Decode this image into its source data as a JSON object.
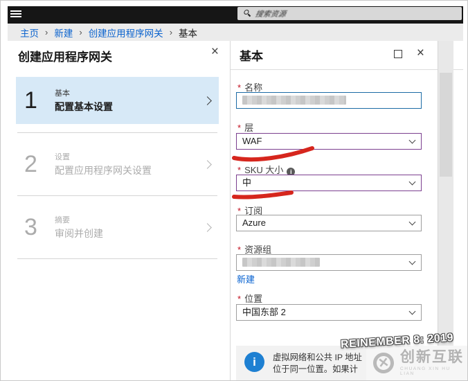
{
  "topbar": {
    "search_placeholder": "搜索资源"
  },
  "breadcrumb": {
    "separator": "›",
    "items": [
      {
        "label": "主页"
      },
      {
        "label": "新建"
      },
      {
        "label": "创建应用程序网关"
      },
      {
        "label": "基本"
      }
    ]
  },
  "left_panel": {
    "title": "创建应用程序网关",
    "steps": [
      {
        "number": "1",
        "label": "基本",
        "sublabel": "配置基本设置",
        "active": true
      },
      {
        "number": "2",
        "label": "设置",
        "sublabel": "配置应用程序网关设置",
        "active": false
      },
      {
        "number": "3",
        "label": "摘要",
        "sublabel": "审阅并创建",
        "active": false
      }
    ]
  },
  "right_panel": {
    "title": "基本",
    "required_marker": "*",
    "fields": {
      "name": {
        "label": "名称",
        "value_redacted": true
      },
      "tier": {
        "label": "层",
        "value": "WAF"
      },
      "sku": {
        "label": "SKU 大小",
        "value": "中"
      },
      "subscription": {
        "label": "订阅",
        "value": "Azure"
      },
      "resource_group": {
        "label": "资源组",
        "value_redacted": true,
        "action_link": "新建"
      },
      "location": {
        "label": "位置",
        "value": "中国东部 2"
      }
    },
    "info_box": {
      "lines": [
        "虚拟网络和公共 IP 地址",
        "位于同一位置。如果计"
      ]
    }
  },
  "watermark": "REINEMBER 8: 2019",
  "logo": {
    "name": "创新互联",
    "sub": "CHUANG XIN HU LIAN",
    "mark": "✕"
  },
  "icons": {
    "close": "×",
    "info": "i"
  },
  "colors": {
    "accent_blue": "#1c6ba5",
    "purple": "#7b3f8f",
    "annotation_red": "#d6261d",
    "link_blue": "#0460d0",
    "info_blue": "#1e80d2",
    "active_step_bg": "#d7e9f7"
  }
}
